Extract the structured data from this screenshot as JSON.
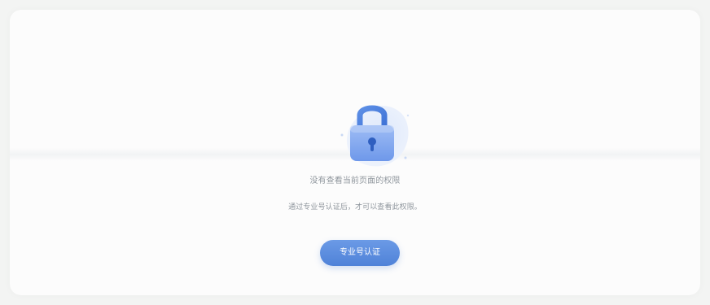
{
  "empty_state": {
    "icon": "lock-icon",
    "primary_message": "没有查看当前页面的权限",
    "secondary_message": "通过专业号认证后，才可以查看此权限。"
  },
  "actions": {
    "certify_label": "专业号认证"
  },
  "colors": {
    "accent": "#5b8be0",
    "text_muted": "#8f969d",
    "background": "#f3f4f3",
    "card": "#fcfcfc"
  }
}
